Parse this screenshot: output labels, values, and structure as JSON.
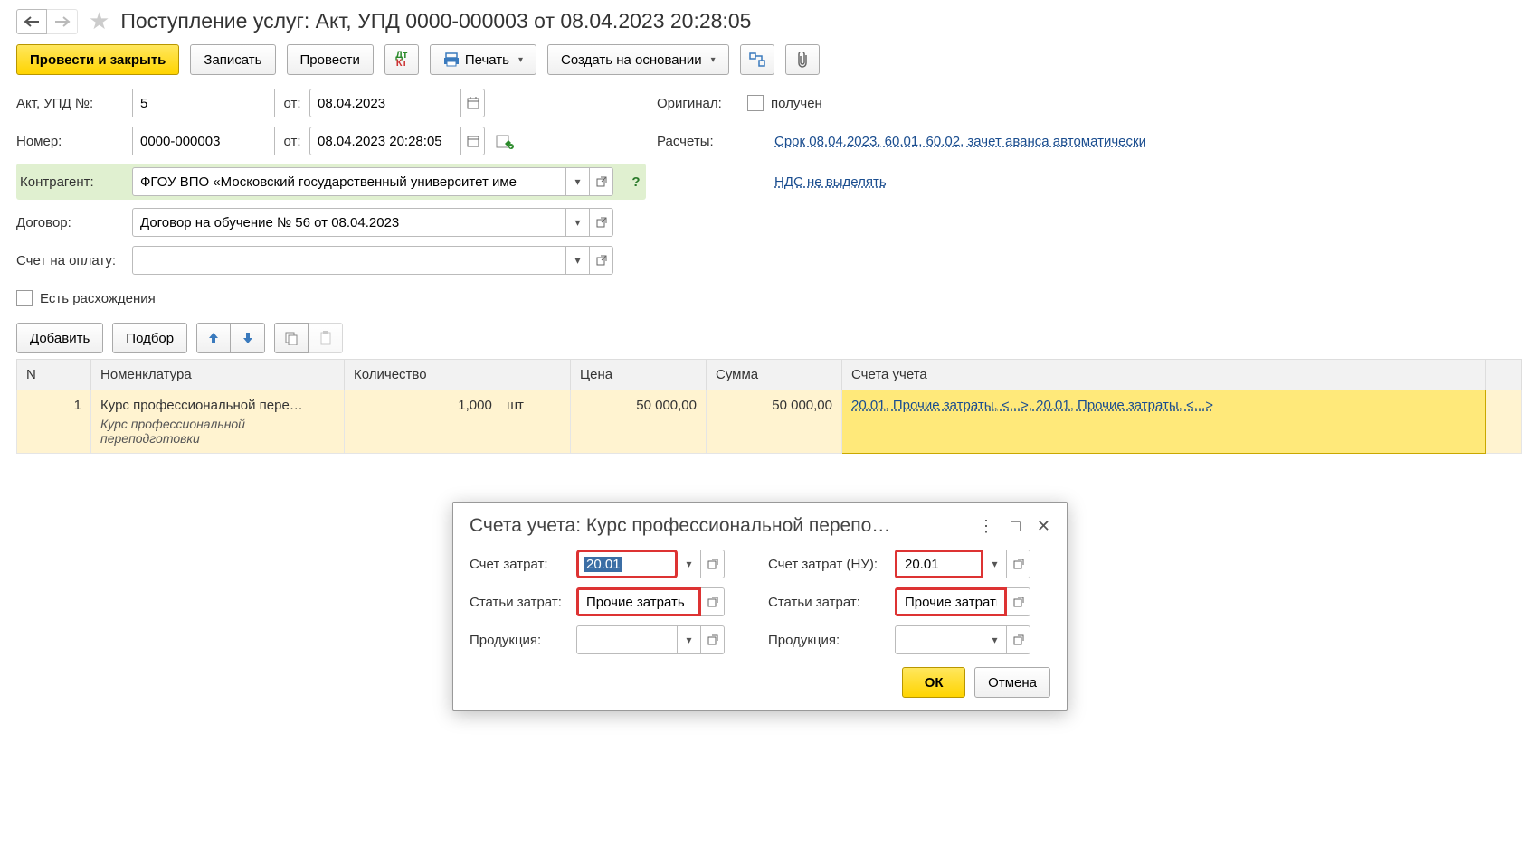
{
  "header": {
    "title": "Поступление услуг: Акт, УПД 0000-000003 от 08.04.2023 20:28:05"
  },
  "toolbar": {
    "post_close": "Провести и закрыть",
    "write": "Записать",
    "post": "Провести",
    "print": "Печать",
    "create_based": "Создать на основании"
  },
  "form": {
    "act_lbl": "Акт, УПД №:",
    "act_val": "5",
    "from_lbl": "от:",
    "act_date": "08.04.2023",
    "num_lbl": "Номер:",
    "num_val": "0000-000003",
    "num_date": "08.04.2023 20:28:05",
    "contr_lbl": "Контрагент:",
    "contr_val": "ФГОУ ВПО «Московский государственный университет име",
    "dogovor_lbl": "Договор:",
    "dogovor_val": "Договор на обучение № 56 от 08.04.2023",
    "invoice_lbl": "Счет на оплату:",
    "invoice_val": "",
    "diverg_lbl": "Есть расхождения",
    "orig_lbl": "Оригинал:",
    "orig_chk": "получен",
    "calc_lbl": "Расчеты:",
    "calc_link": "Срок 08.04.2023, 60.01, 60.02, зачет аванса автоматически",
    "nds_link": "НДС не выделять"
  },
  "tbl_toolbar": {
    "add": "Добавить",
    "pick": "Подбор"
  },
  "table": {
    "cols": {
      "n": "N",
      "nom": "Номенклатура",
      "qty": "Количество",
      "price": "Цена",
      "sum": "Сумма",
      "acc": "Счета учета"
    },
    "row": {
      "n": "1",
      "nom": "Курс профессиональной пере…",
      "nom_full": "Курс профессиональной переподготовки",
      "qty": "1,000",
      "unit": "шт",
      "price": "50 000,00",
      "sum": "50 000,00",
      "acc": "20.01, Прочие затраты, <...>, 20.01, Прочие затраты, <...>"
    }
  },
  "popup": {
    "title": "Счета учета: Курс профессиональной перепо…",
    "left": {
      "acc_lbl": "Счет затрат:",
      "acc_val": "20.01",
      "art_lbl": "Статьи затрат:",
      "art_val": "Прочие затрать",
      "prod_lbl": "Продукция:",
      "prod_val": ""
    },
    "right": {
      "acc_lbl": "Счет затрат (НУ):",
      "acc_val": "20.01",
      "art_lbl": "Статьи затрат:",
      "art_val": "Прочие затраты",
      "prod_lbl": "Продукция:",
      "prod_val": ""
    },
    "ok": "ОК",
    "cancel": "Отмена"
  }
}
